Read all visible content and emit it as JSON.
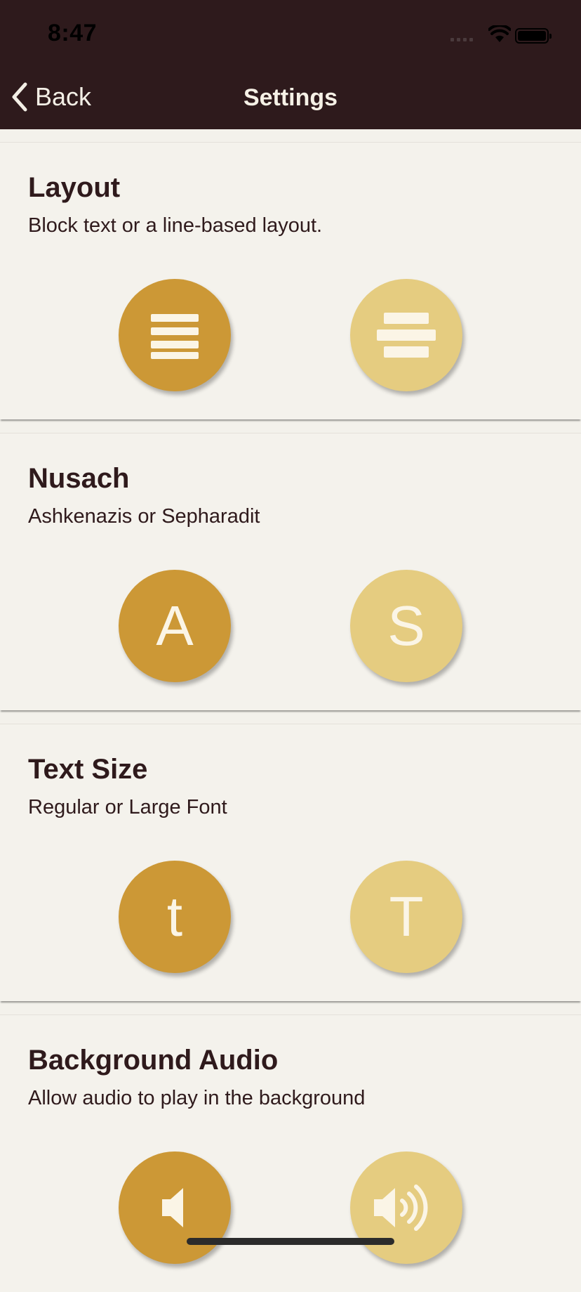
{
  "status_bar": {
    "time": "8:47"
  },
  "nav": {
    "back_label": "Back",
    "title": "Settings"
  },
  "sections": [
    {
      "title": "Layout",
      "description": "Block text or a line-based layout.",
      "options": [
        {
          "icon": "justify-lines-icon"
        },
        {
          "icon": "centered-lines-icon"
        }
      ]
    },
    {
      "title": "Nusach",
      "description": "Ashkenazis or Sepharadit",
      "options": [
        {
          "label": "A"
        },
        {
          "label": "S"
        }
      ]
    },
    {
      "title": "Text Size",
      "description": "Regular or Large Font",
      "options": [
        {
          "label": "t"
        },
        {
          "label": "T"
        }
      ]
    },
    {
      "title": "Background Audio",
      "description": "Allow audio to play in the background",
      "options": [
        {
          "icon": "speaker-muted-icon"
        },
        {
          "icon": "speaker-on-icon"
        }
      ]
    }
  ],
  "colors": {
    "header_bg": "#2e1a1c",
    "section_bg": "#f4f2ec",
    "selected": "#cc9836",
    "unselected": "#e5cc80",
    "text": "#2f1a1c"
  }
}
